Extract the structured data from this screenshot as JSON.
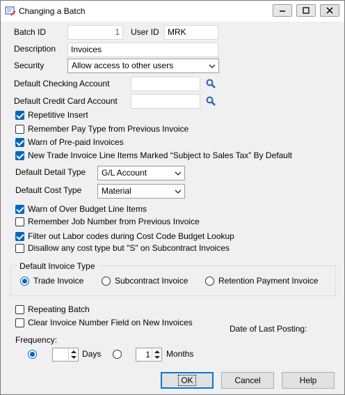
{
  "window": {
    "title": "Changing a Batch"
  },
  "titlebar_buttons": {
    "minimize": "minimize-icon",
    "maximize": "maximize-icon",
    "close": "close-icon"
  },
  "fields": {
    "batch_id_label": "Batch ID",
    "batch_id_value": "1",
    "user_id_label": "User ID",
    "user_id_value": "MRK",
    "description_label": "Description",
    "description_value": "Invoices",
    "security_label": "Security",
    "security_value": "Allow access to other users",
    "checking_label": "Default Checking Account",
    "checking_value": "",
    "credit_label": "Default Credit Card Account",
    "credit_value": ""
  },
  "checks1": [
    {
      "label": "Repetitive Insert",
      "checked": true
    },
    {
      "label": "Remember Pay Type from Previous Invoice",
      "checked": false
    },
    {
      "label": "Warn of Pre-paid Invoices",
      "checked": true
    },
    {
      "label": "New Trade Invoice Line Items Marked “Subject to Sales Tax” By Default",
      "checked": true
    }
  ],
  "detail_type": {
    "label": "Default Detail Type",
    "value": "G/L Account"
  },
  "cost_type": {
    "label": "Default Cost Type",
    "value": "Material"
  },
  "checks2": [
    {
      "label": "Warn of Over Budget Line Items",
      "checked": true
    },
    {
      "label": "Remember Job Number from Previous Invoice",
      "checked": false
    },
    {
      "label": "Filter out Labor codes during Cost Code Budget Lookup",
      "checked": true
    },
    {
      "label": "Disallow any cost type but \"S\" on Subcontract Invoices",
      "checked": false
    }
  ],
  "invoice_type": {
    "title": "Default Invoice Type",
    "options": [
      "Trade Invoice",
      "Subcontract Invoice",
      "Retention Payment Invoice"
    ],
    "selected": "Trade Invoice"
  },
  "checks3": [
    {
      "label": "Repeating Batch",
      "checked": false
    },
    {
      "label": "Clear Invoice Number Field on New Invoices",
      "checked": false
    }
  ],
  "last_posting_label": "Date of Last Posting:",
  "frequency": {
    "label": "Frequency:",
    "days_value": "",
    "days_label": "Days",
    "months_value": "1",
    "months_label": "Months",
    "selected": "Days"
  },
  "buttons": {
    "ok": "OK",
    "cancel": "Cancel",
    "help": "Help"
  },
  "colors": {
    "accent": "#0067c0",
    "search_icon": "#1f5fbf"
  }
}
